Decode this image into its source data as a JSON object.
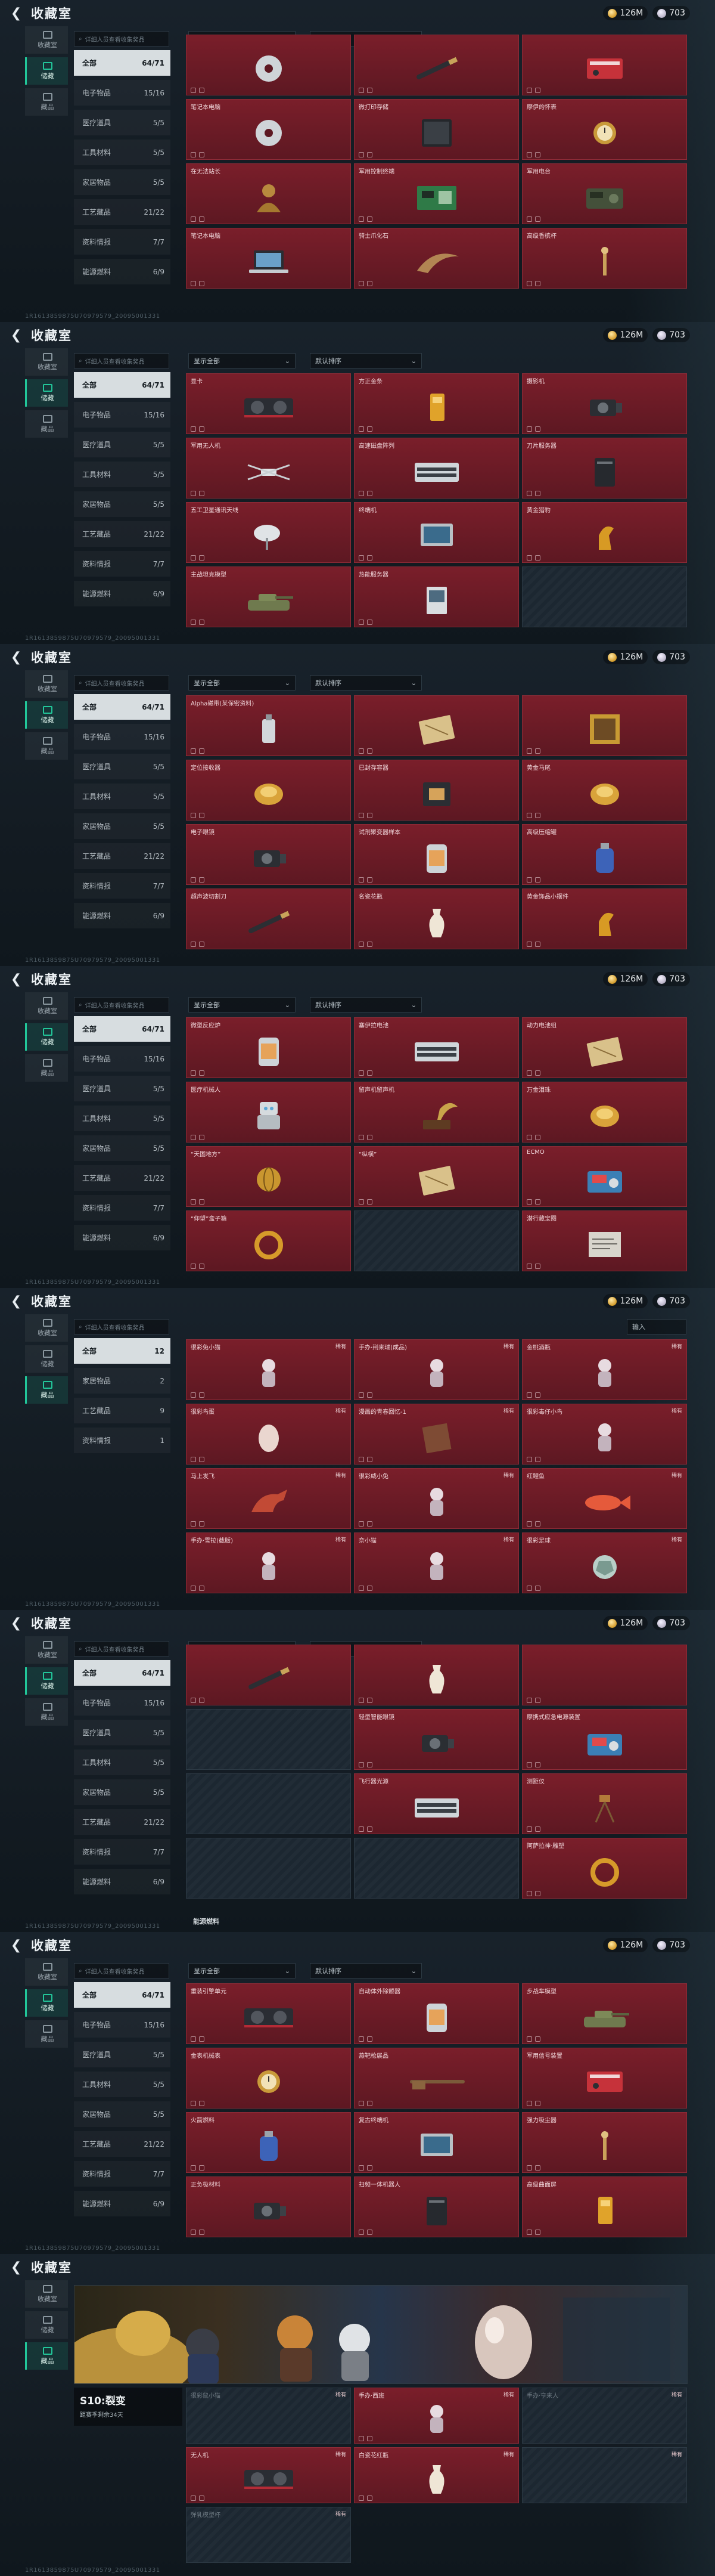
{
  "panels": [
    {
      "title": "收藏室",
      "currency": "126M",
      "premium": "703",
      "search": "详细人员查看收集奖品",
      "sort": "显示全部",
      "order": "默认排序",
      "tabs": [
        {
          "label": "收藏室",
          "on": false
        },
        {
          "label": "储藏",
          "on": true
        },
        {
          "label": "藏品",
          "on": false
        }
      ],
      "cats": [
        {
          "label": "全部",
          "count": "64/71",
          "on": true
        },
        {
          "label": "电子物品",
          "count": "15/16"
        },
        {
          "label": "医疗道具",
          "count": "5/5"
        },
        {
          "label": "工具材料",
          "count": "5/5"
        },
        {
          "label": "家居物品",
          "count": "5/5"
        },
        {
          "label": "工艺藏品",
          "count": "21/22"
        },
        {
          "label": "资料情报",
          "count": "7/7"
        },
        {
          "label": "能源燃料",
          "count": "6/9"
        }
      ],
      "top": true,
      "items": [
        {
          "name": "",
          "tag": "",
          "icon": "disc-icon"
        },
        {
          "name": "",
          "tag": "",
          "icon": "pen-icon"
        },
        {
          "name": "",
          "tag": "",
          "icon": "box-icon"
        },
        {
          "name": "笔记本电脑",
          "tag": "",
          "icon": "disc-icon"
        },
        {
          "name": "微打印存储",
          "tag": "",
          "icon": "tablet-icon"
        },
        {
          "name": "摩伊的怀表",
          "tag": "",
          "icon": "watch-icon"
        },
        {
          "name": "在无法站长",
          "tag": "",
          "icon": "bust-icon"
        },
        {
          "name": "军用控制终端",
          "tag": "",
          "icon": "board-icon"
        },
        {
          "name": "军用电台",
          "tag": "",
          "icon": "radio-icon"
        },
        {
          "name": "笔记本电脑",
          "tag": "",
          "icon": "laptop-icon"
        },
        {
          "name": "骑士爪化石",
          "tag": "",
          "icon": "claw-icon"
        },
        {
          "name": "高级香槟杯",
          "tag": "",
          "icon": "tool-icon"
        }
      ],
      "footer": "",
      "meta": "1R1613859875U70979579_20095001331"
    },
    {
      "title": "收藏室",
      "currency": "126M",
      "premium": "703",
      "search": "详细人员查看收集奖品",
      "sort": "显示全部",
      "order": "默认排序",
      "tabs": [
        {
          "label": "收藏室",
          "on": false
        },
        {
          "label": "储藏",
          "on": true
        },
        {
          "label": "藏品",
          "on": false
        }
      ],
      "cats": [
        {
          "label": "全部",
          "count": "64/71",
          "on": true
        },
        {
          "label": "电子物品",
          "count": "15/16"
        },
        {
          "label": "医疗道具",
          "count": "5/5"
        },
        {
          "label": "工具材料",
          "count": "5/5"
        },
        {
          "label": "家居物品",
          "count": "5/5"
        },
        {
          "label": "工艺藏品",
          "count": "21/22"
        },
        {
          "label": "资料情报",
          "count": "7/7"
        },
        {
          "label": "能源燃料",
          "count": "6/9"
        }
      ],
      "items": [
        {
          "name": "显卡",
          "tag": "",
          "icon": "gpu-icon"
        },
        {
          "name": "方正金条",
          "tag": "",
          "icon": "bar-icon"
        },
        {
          "name": "摄影机",
          "tag": "",
          "icon": "camera-icon"
        },
        {
          "name": "军用无人机",
          "tag": "",
          "icon": "drone-icon"
        },
        {
          "name": "高速磁盘阵列",
          "tag": "",
          "icon": "server-icon"
        },
        {
          "name": "刀片服务器",
          "tag": "",
          "icon": "tower-icon"
        },
        {
          "name": "五工卫星通讯天线",
          "tag": "",
          "icon": "dish-icon"
        },
        {
          "name": "终端机",
          "tag": "",
          "icon": "monitor-icon"
        },
        {
          "name": "黄金猎豹",
          "tag": "",
          "icon": "statue-icon"
        },
        {
          "name": "主战坦克模型",
          "tag": "",
          "icon": "tank-icon"
        },
        {
          "name": "热能服务器",
          "tag": "",
          "icon": "card-icon"
        },
        {
          "name": "",
          "tag": "",
          "icon": "none",
          "locked": true
        }
      ],
      "footer": "",
      "meta": "1R1613859875U70979579_20095001331"
    },
    {
      "title": "收藏室",
      "currency": "126M",
      "premium": "703",
      "search": "详细人员查看收集奖品",
      "sort": "显示全部",
      "order": "默认排序",
      "tabs": [
        {
          "label": "收藏室",
          "on": false
        },
        {
          "label": "储藏",
          "on": true
        },
        {
          "label": "藏品",
          "on": false
        }
      ],
      "cats": [
        {
          "label": "全部",
          "count": "64/71",
          "on": true
        },
        {
          "label": "电子物品",
          "count": "15/16"
        },
        {
          "label": "医疗道具",
          "count": "5/5"
        },
        {
          "label": "工具材料",
          "count": "5/5"
        },
        {
          "label": "家居物品",
          "count": "5/5"
        },
        {
          "label": "工艺藏品",
          "count": "21/22"
        },
        {
          "label": "资料情报",
          "count": "7/7"
        },
        {
          "label": "能源燃料",
          "count": "6/9"
        }
      ],
      "items": [
        {
          "name": "Alpha磁带(某保密资料)",
          "tag": "",
          "icon": "bottle-icon"
        },
        {
          "name": "",
          "tag": "",
          "icon": "map-icon"
        },
        {
          "name": "",
          "tag": "",
          "icon": "frame-icon"
        },
        {
          "name": "定位接收器",
          "tag": "",
          "icon": "gold-icon"
        },
        {
          "name": "已封存容器",
          "tag": "",
          "icon": "chip-icon"
        },
        {
          "name": "黄金马尾",
          "tag": "",
          "icon": "gold-icon"
        },
        {
          "name": "电子眼镜",
          "tag": "",
          "icon": "camera-icon"
        },
        {
          "name": "试剂聚变器样本",
          "tag": "",
          "icon": "canister-icon"
        },
        {
          "name": "高级压缩罐",
          "tag": "",
          "icon": "tank2-icon"
        },
        {
          "name": "超声波切割刀",
          "tag": "",
          "icon": "pen-icon"
        },
        {
          "name": "名瓷花瓶",
          "tag": "",
          "icon": "vase-icon"
        },
        {
          "name": "黄金饰品小摆件",
          "tag": "",
          "icon": "statue-icon"
        }
      ],
      "footer": "",
      "meta": "1R1613859875U70979579_20095001331"
    },
    {
      "title": "收藏室",
      "currency": "126M",
      "premium": "703",
      "search": "详细人员查看收集奖品",
      "sort": "显示全部",
      "order": "默认排序",
      "tabs": [
        {
          "label": "收藏室",
          "on": false
        },
        {
          "label": "储藏",
          "on": true
        },
        {
          "label": "藏品",
          "on": false
        }
      ],
      "cats": [
        {
          "label": "全部",
          "count": "64/71",
          "on": true
        },
        {
          "label": "电子物品",
          "count": "15/16"
        },
        {
          "label": "医疗道具",
          "count": "5/5"
        },
        {
          "label": "工具材料",
          "count": "5/5"
        },
        {
          "label": "家居物品",
          "count": "5/5"
        },
        {
          "label": "工艺藏品",
          "count": "21/22"
        },
        {
          "label": "资料情报",
          "count": "7/7"
        },
        {
          "label": "能源燃料",
          "count": "6/9"
        }
      ],
      "items": [
        {
          "name": "微型反应炉",
          "tag": "",
          "icon": "canister-icon"
        },
        {
          "name": "塞伊拉电池",
          "tag": "",
          "icon": "server-icon"
        },
        {
          "name": "动力电池组",
          "tag": "",
          "icon": "map-icon"
        },
        {
          "name": "医疗机械人",
          "tag": "",
          "icon": "robot-icon"
        },
        {
          "name": "留声机留声机",
          "tag": "",
          "icon": "phono-icon"
        },
        {
          "name": "万金泪珠",
          "tag": "",
          "icon": "gold-icon"
        },
        {
          "name": "“天图地方”",
          "tag": "",
          "icon": "globe-icon"
        },
        {
          "name": "“纵横”",
          "tag": "",
          "icon": "map-icon"
        },
        {
          "name": "ECMO",
          "tag": "",
          "icon": "ecmo-icon"
        },
        {
          "name": "“仰望”盒子箱",
          "tag": "",
          "icon": "ring-icon"
        },
        {
          "name": "",
          "tag": "",
          "icon": "none",
          "locked": true
        },
        {
          "name": "潜行藏宝图",
          "tag": "",
          "icon": "paper-icon"
        }
      ],
      "footer": "",
      "meta": "1R1613859875U70979579_20095001331"
    },
    {
      "title": "收藏室",
      "currency": "126M",
      "premium": "703",
      "search": "详细人员查看收集奖品",
      "sort": "",
      "order": "",
      "input": "输入",
      "tabs": [
        {
          "label": "收藏室",
          "on": false
        },
        {
          "label": "储藏",
          "on": false
        },
        {
          "label": "藏品",
          "on": true
        }
      ],
      "cats": [
        {
          "label": "全部",
          "count": "12",
          "on": true
        },
        {
          "label": "家居物品",
          "count": "2"
        },
        {
          "label": "工艺藏品",
          "count": "9"
        },
        {
          "label": "资料情报",
          "count": "1"
        }
      ],
      "items": [
        {
          "name": "很彩兔小猫",
          "tag": "稀有",
          "icon": "figure-icon"
        },
        {
          "name": "手办·荆来瑞(成品)",
          "tag": "稀有",
          "icon": "figure-icon"
        },
        {
          "name": "金桃酒瓶",
          "tag": "稀有",
          "icon": "figure-icon"
        },
        {
          "name": "很彩鸟蛋",
          "tag": "稀有",
          "icon": "egg-icon"
        },
        {
          "name": "漫画的青春回忆-1",
          "tag": "稀有",
          "icon": "book-icon"
        },
        {
          "name": "很彩毒仔小鸟",
          "tag": "稀有",
          "icon": "figure-icon"
        },
        {
          "name": "马上发飞",
          "tag": "稀有",
          "icon": "horse-icon"
        },
        {
          "name": "很彩威小兔",
          "tag": "稀有",
          "icon": "figure-icon"
        },
        {
          "name": "红鲤鱼",
          "tag": "稀有",
          "icon": "fish-icon"
        },
        {
          "name": "手办·雪拉(截版)",
          "tag": "稀有",
          "icon": "figure-icon"
        },
        {
          "name": "奈小猫",
          "tag": "稀有",
          "icon": "figure-icon"
        },
        {
          "name": "很彩足球",
          "tag": "稀有",
          "icon": "ball-icon"
        }
      ],
      "footer": "",
      "meta": "1R1613859875U70979579_20095001331"
    },
    {
      "title": "收藏室",
      "currency": "126M",
      "premium": "703",
      "search": "详细人员查看收集奖品",
      "sort": "显示全部",
      "order": "默认排序",
      "tabs": [
        {
          "label": "收藏室",
          "on": false
        },
        {
          "label": "储藏",
          "on": true
        },
        {
          "label": "藏品",
          "on": false
        }
      ],
      "cats": [
        {
          "label": "全部",
          "count": "64/71",
          "on": true
        },
        {
          "label": "电子物品",
          "count": "15/16"
        },
        {
          "label": "医疗道具",
          "count": "5/5"
        },
        {
          "label": "工具材料",
          "count": "5/5"
        },
        {
          "label": "家居物品",
          "count": "5/5"
        },
        {
          "label": "工艺藏品",
          "count": "21/22"
        },
        {
          "label": "资料情报",
          "count": "7/7"
        },
        {
          "label": "能源燃料",
          "count": "6/9"
        }
      ],
      "top": true,
      "items": [
        {
          "name": "",
          "tag": "",
          "icon": "pen-icon"
        },
        {
          "name": "",
          "tag": "",
          "icon": "vase-icon"
        },
        {
          "name": "",
          "tag": "",
          "icon": "none"
        },
        {
          "name": "",
          "tag": "",
          "icon": "none",
          "locked": true
        },
        {
          "name": "轻型智能眼镜",
          "tag": "",
          "icon": "camera-icon"
        },
        {
          "name": "摩携式应急电源装置",
          "tag": "",
          "icon": "ecmo-icon"
        },
        {
          "name": "",
          "tag": "",
          "icon": "none",
          "locked": true
        },
        {
          "name": "飞行器光源",
          "tag": "",
          "icon": "server-icon"
        },
        {
          "name": "测距仪",
          "tag": "",
          "icon": "tripod-icon"
        },
        {
          "name": "",
          "tag": "",
          "icon": "none",
          "locked": true
        },
        {
          "name": "",
          "tag": "",
          "icon": "none",
          "locked": true
        },
        {
          "name": "阿萨拉神·雕塑",
          "tag": "",
          "icon": "ring-icon"
        }
      ],
      "footer": "能源燃料",
      "meta": "1R1613859875U70979579_20095001331"
    },
    {
      "title": "收藏室",
      "currency": "126M",
      "premium": "703",
      "search": "详细人员查看收集奖品",
      "sort": "显示全部",
      "order": "默认排序",
      "tabs": [
        {
          "label": "收藏室",
          "on": false
        },
        {
          "label": "储藏",
          "on": true
        },
        {
          "label": "藏品",
          "on": false
        }
      ],
      "cats": [
        {
          "label": "全部",
          "count": "64/71",
          "on": true
        },
        {
          "label": "电子物品",
          "count": "15/16"
        },
        {
          "label": "医疗道具",
          "count": "5/5"
        },
        {
          "label": "工具材料",
          "count": "5/5"
        },
        {
          "label": "家居物品",
          "count": "5/5"
        },
        {
          "label": "工艺藏品",
          "count": "21/22"
        },
        {
          "label": "资料情报",
          "count": "7/7"
        },
        {
          "label": "能源燃料",
          "count": "6/9"
        }
      ],
      "items": [
        {
          "name": "重装引擎单元",
          "tag": "",
          "icon": "gpu-icon"
        },
        {
          "name": "自动体外除颤器",
          "tag": "",
          "icon": "canister-icon"
        },
        {
          "name": "步战车模型",
          "tag": "",
          "icon": "tank-icon"
        },
        {
          "name": "金表机械表",
          "tag": "",
          "icon": "watch-icon"
        },
        {
          "name": "燕靶枪展品",
          "tag": "",
          "icon": "rifle-icon"
        },
        {
          "name": "军用信号装置",
          "tag": "",
          "icon": "box-icon"
        },
        {
          "name": "火箭燃料",
          "tag": "",
          "icon": "tank2-icon"
        },
        {
          "name": "复古终端机",
          "tag": "",
          "icon": "monitor-icon"
        },
        {
          "name": "强力吸尘器",
          "tag": "",
          "icon": "tool-icon"
        },
        {
          "name": "正负极材料",
          "tag": "",
          "icon": "camera-icon"
        },
        {
          "name": "扫频一体机器人",
          "tag": "",
          "icon": "tower-icon"
        },
        {
          "name": "高级曲面屏",
          "tag": "",
          "icon": "bar-icon"
        }
      ],
      "footer": "",
      "meta": "1R1613859875U70979579_20095001331"
    },
    {
      "title": "收藏室",
      "currency": "",
      "premium": "",
      "search": "",
      "sort": "",
      "order": "",
      "tabs": [
        {
          "label": "收藏室",
          "on": false
        },
        {
          "label": "储藏",
          "on": false
        },
        {
          "label": "藏品",
          "on": true
        }
      ],
      "cats": [],
      "season": {
        "name": "S10:裂变",
        "sub": "距赛季剩余34天"
      },
      "items": [
        {
          "name": "很彩鼠小猫",
          "tag": "稀有",
          "icon": "none",
          "locked": true
        },
        {
          "name": "手办·西班",
          "tag": "稀有",
          "icon": "figure-icon"
        },
        {
          "name": "手办·亨来人",
          "tag": "稀有",
          "icon": "none",
          "locked": true
        },
        {
          "name": "无人机",
          "tag": "稀有",
          "icon": "gpu-icon"
        },
        {
          "name": "白瓷花红瓶",
          "tag": "稀有",
          "icon": "vase-icon"
        },
        {
          "name": "",
          "tag": "稀有",
          "icon": "none",
          "locked": true
        },
        {
          "name": "弹乳模型杯",
          "tag": "稀有",
          "icon": "none",
          "locked": true
        }
      ],
      "footer": "",
      "meta": "1R1613859875U70979579_20095001331"
    }
  ]
}
